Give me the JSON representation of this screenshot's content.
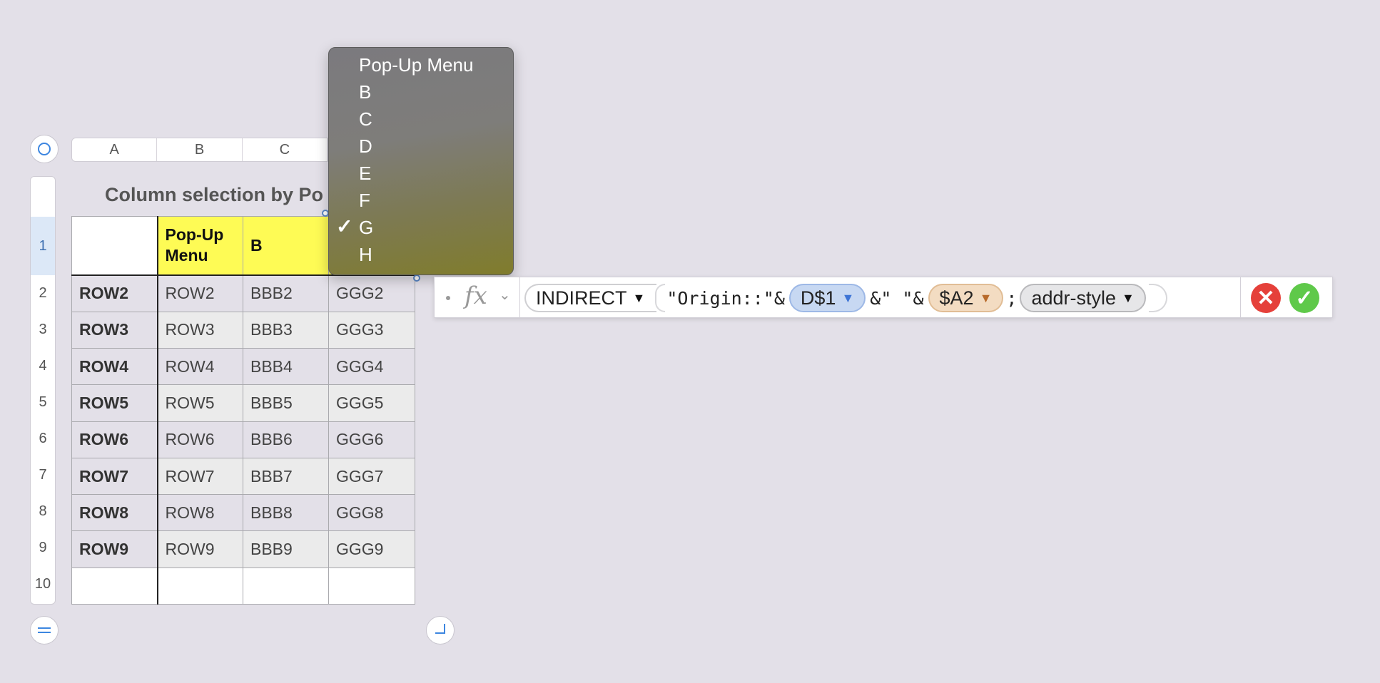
{
  "table": {
    "title": "Column selection by Po",
    "columns": [
      "A",
      "B",
      "C"
    ],
    "row_numbers": [
      "1",
      "2",
      "3",
      "4",
      "5",
      "6",
      "7",
      "8",
      "9",
      "10"
    ],
    "header": {
      "a": "",
      "b": "Pop-Up Menu",
      "c": "B",
      "d": ""
    },
    "rows": [
      {
        "a": "ROW2",
        "b": "ROW2",
        "c": "BBB2",
        "d": "GGG2"
      },
      {
        "a": "ROW3",
        "b": "ROW3",
        "c": "BBB3",
        "d": "GGG3"
      },
      {
        "a": "ROW4",
        "b": "ROW4",
        "c": "BBB4",
        "d": "GGG4"
      },
      {
        "a": "ROW5",
        "b": "ROW5",
        "c": "BBB5",
        "d": "GGG5"
      },
      {
        "a": "ROW6",
        "b": "ROW6",
        "c": "BBB6",
        "d": "GGG6"
      },
      {
        "a": "ROW7",
        "b": "ROW7",
        "c": "BBB7",
        "d": "GGG7"
      },
      {
        "a": "ROW8",
        "b": "ROW8",
        "c": "BBB8",
        "d": "GGG8"
      },
      {
        "a": "ROW9",
        "b": "ROW9",
        "c": "BBB9",
        "d": "GGG9"
      },
      {
        "a": "",
        "b": "",
        "c": "",
        "d": ""
      }
    ]
  },
  "popup_menu": {
    "items": [
      "Pop-Up Menu",
      "B",
      "C",
      "D",
      "E",
      "F",
      "G",
      "H"
    ],
    "selected": "G",
    "check_glyph": "✓"
  },
  "formula_bar": {
    "fx_label": "fx",
    "function_name": "INDIRECT",
    "literal_1": "\"Origin::\"&",
    "ref_1": "D$1",
    "literal_2": "&\" \"&",
    "ref_2": "$A2",
    "separator": ";",
    "arg_3": "addr-style",
    "cancel_glyph": "✕",
    "accept_glyph": "✓"
  },
  "colors": {
    "header_yellow": "#fefb55",
    "ref1_blue": "#c7d8f2",
    "ref2_orange": "#f3dcc2",
    "cancel_red": "#e5403a",
    "accept_green": "#5fc94a"
  }
}
